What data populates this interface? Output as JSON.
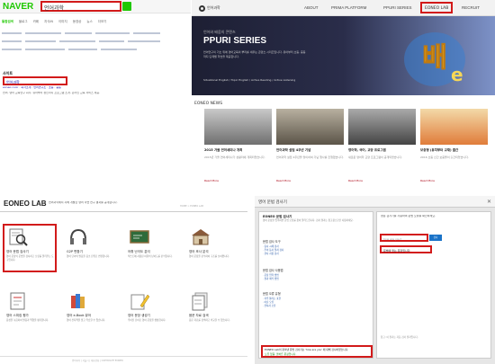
{
  "naver": {
    "logo": "NAVER",
    "query": "언어과학",
    "tabs": [
      "통합검색",
      "블로그",
      "카페",
      "지식iN",
      "이미지",
      "동영상",
      "뉴스",
      "더보기"
    ],
    "site_heading": "사이트",
    "site_title": "언어과학",
    "site_sublinks": "eoneo.co.kr · 회사소개 · 언어연구소 · 초등 · 중등",
    "site_desc": "언어, 영어 교육연구 회사, 유아부터 성인까지 프로그램 소개, 온라인 교육 서비스 제공."
  },
  "site": {
    "logo_text": "언어과학",
    "nav": [
      "ABOUT",
      "PRIMA PLATFORM",
      "PPURI SERIES",
      "EONEO LAB",
      "RECRUIT"
    ],
    "hero_small": "언어와 배움의 콘텐츠",
    "hero_title": "PPURI SERIES",
    "hero_desc": "언어연구의 기초 위에 영어교육의 뿌리를 세우는 콘텐츠 시리즈입니다. 유아부터 초등, 중등까지 단계별 학습을 제공합니다.",
    "hero_tags": "Situational English / Topic English / Active Reading / Active Listening",
    "news_heading": "EONEO NEWS",
    "news": [
      {
        "title": "2015 가을 연어세미나 개최",
        "text": "2015년 가을 연어세미나가 성황리에 개최되었습니다.",
        "more": "Read More"
      },
      {
        "title": "언어과학 설립 4주년 기념",
        "text": "언어과학 설립 4주년을 맞이하여 기념 행사를 진행했습니다.",
        "more": "Read More"
      },
      {
        "title": "영어학, 국어, 교양 프로그램",
        "text": "새로운 영어학 교양 프로그램이 공개되었습니다.",
        "more": "Read More"
      },
      {
        "title": "보충형 (유치부터 교재) 출간",
        "text": "2016 초등 신간 보충물이 출간되었습니다.",
        "more": "Read More"
      }
    ]
  },
  "lab": {
    "title": "EONEO LAB",
    "desc": "언어과학에서 자체 개발한 영어 학습 연구 결과를 공개합니다.",
    "crumb": "HOME > EONEO LAB",
    "items": [
      {
        "name": "영어 문법 검사기",
        "desc": "영어 문장의 문법을 검사하고 오류를 알려주는 도구입니다."
      },
      {
        "name": "G2P 변환기",
        "desc": "영어 단어의 발음을 음소 단위로 변환합니다."
      },
      {
        "name": "어휘 난이도 분석",
        "desc": "텍스트에 사용된 어휘의 난이도를 분석합니다."
      },
      {
        "name": "영어 조사 분석",
        "desc": "영어 문장을 분석하여 구조를 보여줍니다."
      },
      {
        "name": "영어 스피킹 평가",
        "desc": "음성을 녹음하여 발음과 억양을 평가합니다."
      },
      {
        "name": "영어 e-Book 뷰어",
        "desc": "영어 전자책을 읽고 학습할 수 있습니다."
      },
      {
        "name": "영어 문장 생성기",
        "desc": "주어진 단어로 영어 문장을 생성합니다."
      },
      {
        "name": "음운 자료 검색",
        "desc": "음운 자료를 검색하고 비교할 수 있습니다."
      }
    ],
    "footer": "언어과학 | 서울시 | 대표전화 | COPYRIGHT EONEO"
  },
  "dialog": {
    "title": "영어 문법 검사기",
    "close": "✕",
    "left_heading": "EONEO 문법 검사기",
    "left_desc": "영어 문장을 입력하면 문법 오류를 찾아 알려드립니다. 검사 결과는 참고용으로만 사용하세요.",
    "sections": [
      {
        "head": "문법 검사 도구",
        "links": [
          "· 동사 시제 검사",
          "· 주어 동사 일치 검사",
          "· 관사 사용 검사"
        ]
      },
      {
        "head": "문법 검사 사용법",
        "links": [
          "· 문장 입력 방법",
          "· 결과 해석 방법"
        ]
      },
      {
        "head": "문법 오류 유형",
        "links": [
          "· 자주 틀리는 표현",
          "· 어순 오류",
          "· 전치사 오류"
        ]
      }
    ],
    "result_1": "EONEO Lab이 찾아낸 문법 검사기는 'how are you' 에 대해 검사하였습니다.",
    "result_2": "오류 없음: 올바른 문장입니다.",
    "right_head": "영문 검사기를 사용하여 문법 오류를 확인하세요.",
    "input_value": "how are you?",
    "ask_label": "검사",
    "check_label": "문법에 맞는 문장입니다.",
    "right_bottom": "참고: 이 결과는 자동 검사 결과입니다."
  }
}
